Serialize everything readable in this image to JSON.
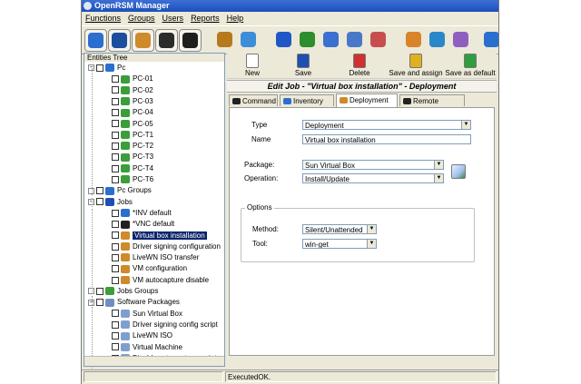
{
  "window": {
    "title": "OpenRSM Manager"
  },
  "menu": [
    "Functions",
    "Groups",
    "Users",
    "Reports",
    "Help"
  ],
  "toolbar": {
    "buttons": [
      {
        "icon": "info-icon",
        "color": "#2a6fcf"
      },
      {
        "icon": "eye-icon",
        "color": "#1c4d9e"
      },
      {
        "icon": "tools-icon",
        "color": "#cf8a2a"
      },
      {
        "icon": "monitor-graph-icon",
        "color": "#2b2b2b"
      },
      {
        "icon": "console-icon",
        "color": "#1e1e1e"
      },
      {
        "icon": "gear-icon",
        "color": "#b67a1c"
      },
      {
        "icon": "package-icon",
        "color": "#3c8ed8"
      },
      {
        "icon": "cube-icon",
        "color": "#1f58c6"
      },
      {
        "icon": "cubes-icon",
        "color": "#2c8e2c"
      },
      {
        "icon": "network-icon",
        "color": "#3b6fd0"
      },
      {
        "icon": "network-icon",
        "color": "#4a78c8"
      },
      {
        "icon": "chart-icon",
        "color": "#c84e4e"
      },
      {
        "icon": "users-icon",
        "color": "#d9832b"
      },
      {
        "icon": "pie-icon",
        "color": "#2a87c8"
      },
      {
        "icon": "search-doc-icon",
        "color": "#8f5fbf"
      },
      {
        "icon": "globe-icon",
        "color": "#2a6fcf"
      }
    ]
  },
  "tree": {
    "header": "Entities Tree",
    "nodes": [
      {
        "label": "Pc",
        "level": 0,
        "expander": "−",
        "icon": "computer-icon",
        "color": "#2a6fcf"
      },
      {
        "label": "PC-01",
        "level": 1,
        "icon": "pc-icon",
        "color": "#3a9e3a"
      },
      {
        "label": "PC-02",
        "level": 1,
        "icon": "pc-icon",
        "color": "#3a9e3a"
      },
      {
        "label": "PC-03",
        "level": 1,
        "icon": "pc-icon",
        "color": "#3a9e3a"
      },
      {
        "label": "PC-04",
        "level": 1,
        "icon": "pc-icon",
        "color": "#3a9e3a"
      },
      {
        "label": "PC-05",
        "level": 1,
        "icon": "pc-icon",
        "color": "#3a9e3a"
      },
      {
        "label": "PC-T1",
        "level": 1,
        "icon": "pc-icon",
        "color": "#3a9e3a"
      },
      {
        "label": "PC-T2",
        "level": 1,
        "icon": "pc-icon",
        "color": "#3a9e3a"
      },
      {
        "label": "PC-T3",
        "level": 1,
        "icon": "pc-icon",
        "color": "#3a9e3a"
      },
      {
        "label": "PC-T4",
        "level": 1,
        "icon": "pc-icon",
        "color": "#3a9e3a"
      },
      {
        "label": "PC-T6",
        "level": 1,
        "icon": "pc-icon",
        "color": "#3a9e3a"
      },
      {
        "label": "Pc Groups",
        "level": 0,
        "expander": "",
        "icon": "group-icon",
        "color": "#2a6fcf"
      },
      {
        "label": "Jobs",
        "level": 0,
        "expander": "−",
        "icon": "jobs-icon",
        "color": "#1f4fb0"
      },
      {
        "label": "*INV default",
        "level": 1,
        "icon": "info-icon",
        "color": "#2a6fcf"
      },
      {
        "label": "*VNC default",
        "level": 1,
        "icon": "console-icon",
        "color": "#222222"
      },
      {
        "label": "Virtual box installation",
        "level": 1,
        "icon": "wrench-icon",
        "color": "#cf8a2a",
        "selected": true
      },
      {
        "label": "Driver signing configuration",
        "level": 1,
        "icon": "wrench-icon",
        "color": "#cf8a2a"
      },
      {
        "label": "LiveWN ISO transfer",
        "level": 1,
        "icon": "wrench-icon",
        "color": "#cf8a2a"
      },
      {
        "label": "VM configuration",
        "level": 1,
        "icon": "wrench-icon",
        "color": "#cf8a2a"
      },
      {
        "label": "VM autocapture disable",
        "level": 1,
        "icon": "wrench-icon",
        "color": "#cf8a2a"
      },
      {
        "label": "Jobs Groups",
        "level": 0,
        "expander": "",
        "icon": "group-icon",
        "color": "#3a9e3a"
      },
      {
        "label": "Software Packages",
        "level": 0,
        "expander": "−",
        "icon": "software-icon",
        "color": "#6f8fbf"
      },
      {
        "label": "Sun Virtual Box",
        "level": 1,
        "icon": "package-icon",
        "color": "#7f9fcf"
      },
      {
        "label": "Driver signing config script",
        "level": 1,
        "icon": "package-icon",
        "color": "#7f9fcf"
      },
      {
        "label": "LiveWN ISO",
        "level": 1,
        "icon": "package-icon",
        "color": "#7f9fcf"
      },
      {
        "label": "Virtual Machine",
        "level": 1,
        "icon": "package-icon",
        "color": "#7f9fcf"
      },
      {
        "label": "Disable autocapture script",
        "level": 1,
        "icon": "package-icon",
        "color": "#7f9fcf"
      }
    ]
  },
  "actions": [
    {
      "label": "New",
      "icon": "new-icon",
      "color": "#ffffff"
    },
    {
      "label": "Save",
      "icon": "save-icon",
      "color": "#1f4fb0"
    },
    {
      "label": "Delete",
      "icon": "delete-icon",
      "color": "#d03030"
    },
    {
      "label": "Save and assign",
      "icon": "save-assign-icon",
      "color": "#e0b020"
    },
    {
      "label": "Save as default",
      "icon": "save-default-icon",
      "color": "#2e9e3e"
    }
  ],
  "edit_header": "Edit Job - \"Virtual box installation\" - Deployment",
  "tabs": [
    {
      "label": "Command",
      "icon": "console-icon",
      "color": "#222222"
    },
    {
      "label": "Inventory",
      "icon": "info-icon",
      "color": "#2a6fcf"
    },
    {
      "label": "Deployment",
      "icon": "wrench-icon",
      "color": "#cf8a2a",
      "active": true
    },
    {
      "label": "Remote Control",
      "icon": "console-icon",
      "color": "#222222"
    }
  ],
  "form": {
    "type_label": "Type",
    "type_value": "Deployment",
    "name_label": "Name",
    "name_value": "Virtual box installation",
    "package_label": "Package:",
    "package_value": "Sun Virtual Box",
    "operation_label": "Operation:",
    "operation_value": "Install/Update",
    "options": {
      "legend": "Options",
      "method_label": "Method:",
      "method_value": "Silent/Unattended",
      "tool_label": "Tool:",
      "tool_value": "win-get"
    }
  },
  "status": {
    "text": "ExecutedOK."
  }
}
